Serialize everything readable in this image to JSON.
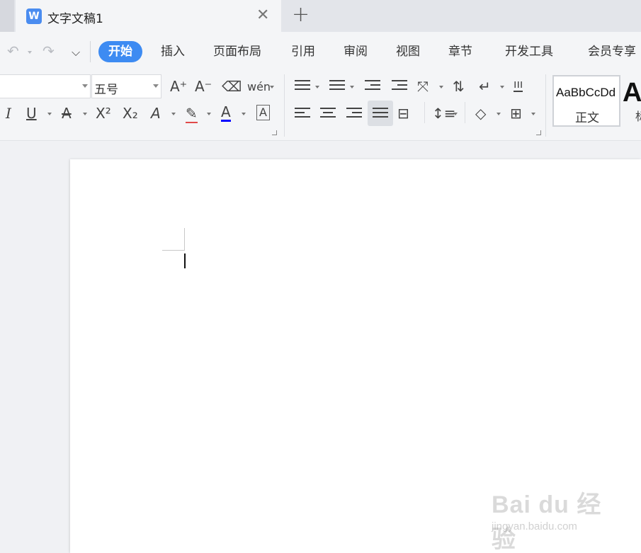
{
  "tab": {
    "icon_letter": "W",
    "title": "文字文稿1",
    "close_glyph": "✕",
    "add_glyph": "+"
  },
  "quick_access": {
    "undo": "↶",
    "redo": "↷",
    "more": "⌵"
  },
  "menu": {
    "items": [
      "开始",
      "插入",
      "页面布局",
      "引用",
      "审阅",
      "视图",
      "章节",
      "开发工具",
      "会员专享"
    ],
    "active": "开始"
  },
  "ribbon": {
    "font_name": "",
    "font_size": "五号",
    "font_buttons": {
      "grow": "A⁺",
      "shrink": "A⁻",
      "clear": "⌫",
      "pinyin": "wén"
    },
    "format_buttons": {
      "italic": "I",
      "underline": "U",
      "strike": "A",
      "superscript": "X²",
      "subscript": "X₂",
      "effects": "A",
      "highlight": "✎",
      "font_color": "A",
      "char_border": "A"
    },
    "accent_color": "#3d8bf2",
    "font_color_bar": "#0000ff"
  },
  "styles": {
    "normal_sample": "AaBbCcDd",
    "normal_name": "正文",
    "heading_sample": "A",
    "heading_name": "标"
  },
  "watermark": {
    "logo": "Bai du 经验",
    "url": "jingyan.baidu.com"
  }
}
